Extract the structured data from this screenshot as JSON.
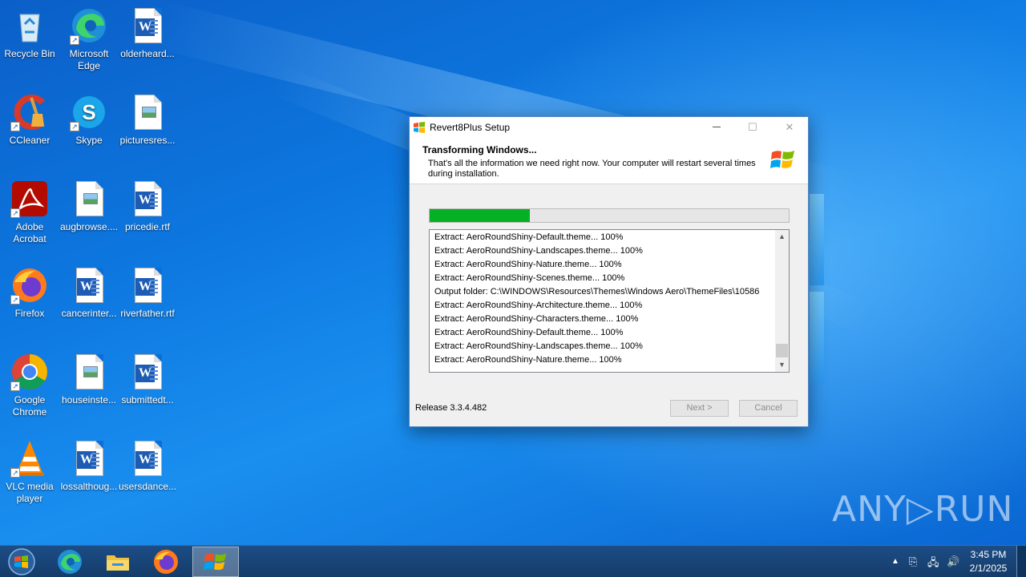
{
  "desktop": {
    "icons": [
      {
        "label": "Recycle Bin",
        "icon": "recycle-bin-icon"
      },
      {
        "label": "Microsoft Edge",
        "icon": "edge-icon"
      },
      {
        "label": "olderheard...",
        "icon": "word-doc-icon"
      },
      {
        "label": "CCleaner",
        "icon": "ccleaner-icon"
      },
      {
        "label": "Skype",
        "icon": "skype-icon"
      },
      {
        "label": "picturesres...",
        "icon": "image-file-icon"
      },
      {
        "label": "Adobe Acrobat",
        "icon": "acrobat-icon"
      },
      {
        "label": "augbrowse....",
        "icon": "image-file-icon"
      },
      {
        "label": "pricedie.rtf",
        "icon": "word-doc-icon"
      },
      {
        "label": "Firefox",
        "icon": "firefox-icon"
      },
      {
        "label": "cancerinter...",
        "icon": "word-doc-icon"
      },
      {
        "label": "riverfather.rtf",
        "icon": "word-doc-icon"
      },
      {
        "label": "Google Chrome",
        "icon": "chrome-icon"
      },
      {
        "label": "houseinste...",
        "icon": "image-file-icon"
      },
      {
        "label": "submittedt...",
        "icon": "word-doc-icon"
      },
      {
        "label": "VLC media player",
        "icon": "vlc-icon"
      },
      {
        "label": "lossalthoug...",
        "icon": "word-doc-icon"
      },
      {
        "label": "usersdance...",
        "icon": "word-doc-icon"
      }
    ]
  },
  "setup": {
    "title": "Revert8Plus Setup",
    "minimize": "—",
    "maximize": "☐",
    "close": "✕",
    "header_title": "Transforming Windows...",
    "header_subtitle": "That's all the information we need right now. Your computer will restart several times during installation.",
    "progress": 0.28,
    "log_lines": [
      "Extract: AeroRoundShiny-Default.theme... 100%",
      "Extract: AeroRoundShiny-Landscapes.theme... 100%",
      "Extract: AeroRoundShiny-Nature.theme... 100%",
      "Extract: AeroRoundShiny-Scenes.theme... 100%",
      "Output folder: C:\\WINDOWS\\Resources\\Themes\\Windows Aero\\ThemeFiles\\10586",
      "Extract: AeroRoundShiny-Architecture.theme... 100%",
      "Extract: AeroRoundShiny-Characters.theme... 100%",
      "Extract: AeroRoundShiny-Default.theme... 100%",
      "Extract: AeroRoundShiny-Landscapes.theme... 100%",
      "Extract: AeroRoundShiny-Nature.theme... 100%"
    ],
    "release": "Release 3.3.4.482",
    "next_label": "Next >",
    "cancel_label": "Cancel"
  },
  "watermark": "ANY▷RUN",
  "taskbar": {
    "items": [
      "start-orb-icon",
      "edge-icon",
      "file-explorer-icon",
      "firefox-icon",
      "revert8plus-setup-icon"
    ],
    "time": "3:45 PM",
    "date": "2/1/2025"
  },
  "colors": {
    "progress_fill": "#06b025",
    "taskbar": "#1c4d85",
    "wallpaper": "#0d78e0"
  }
}
